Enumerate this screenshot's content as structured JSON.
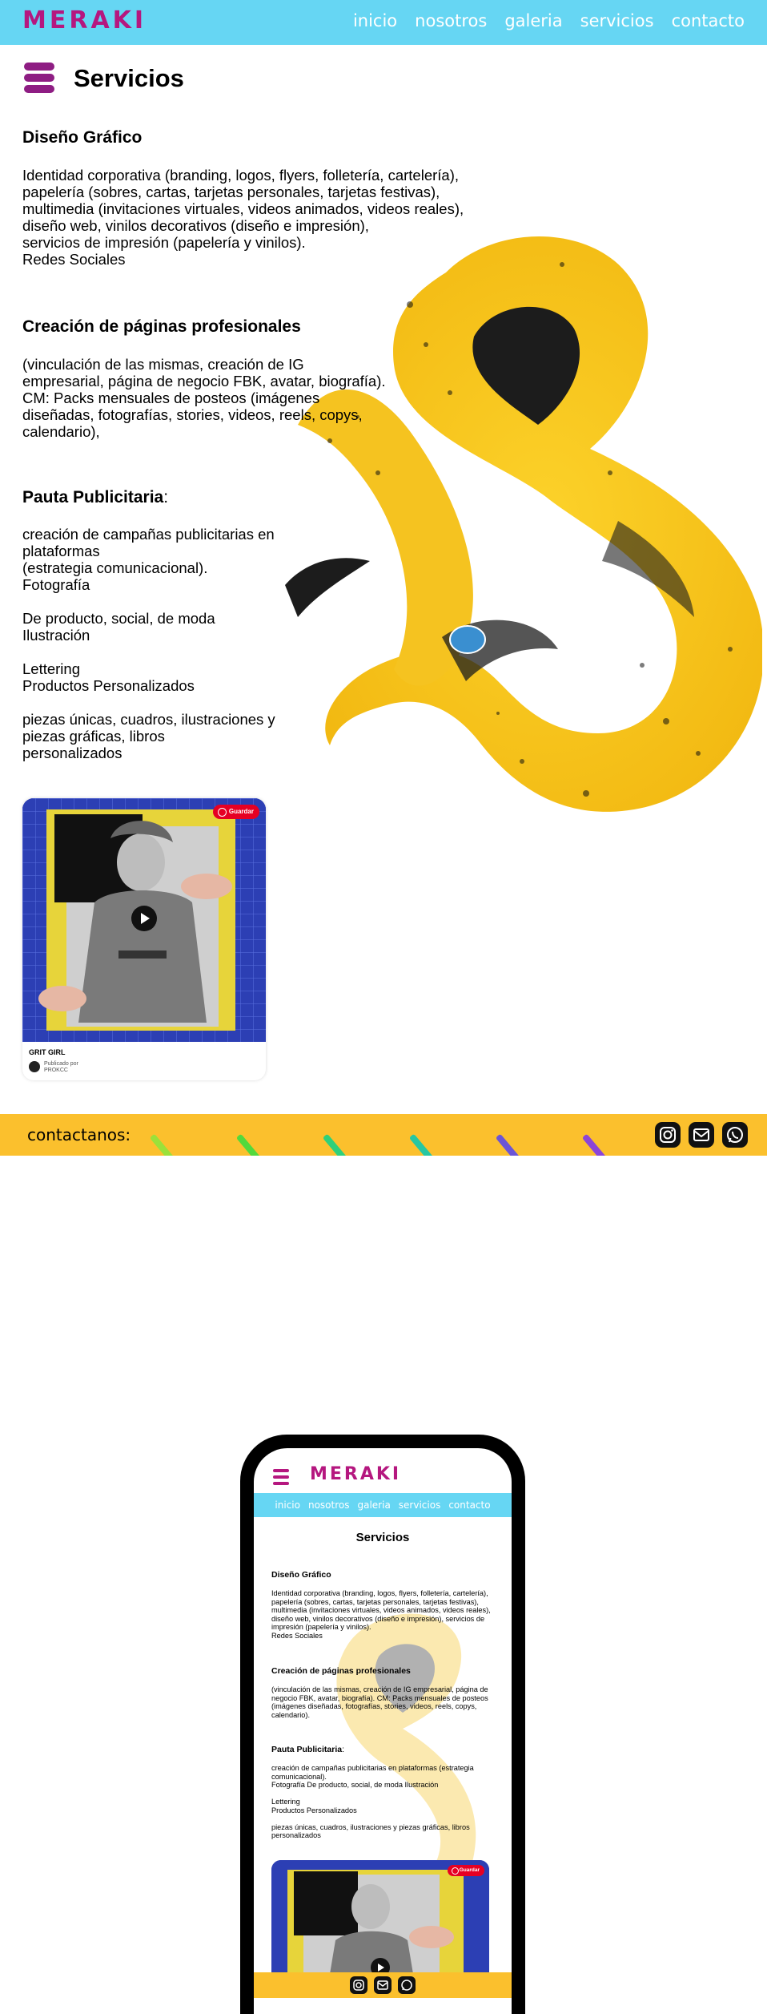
{
  "brand": {
    "logo": "MERAKI",
    "accent": "#b5177f",
    "nav_bg": "#66d6f3",
    "footer_bg": "#fbc02d"
  },
  "nav": {
    "links": [
      "inicio",
      "nosotros",
      "galeria",
      "servicios",
      "contacto"
    ]
  },
  "page": {
    "title": "Servicios"
  },
  "services": [
    {
      "title": "Diseño Gráfico",
      "body": "Identidad corporativa (branding, logos, flyers, folletería, cartelería),\npapelería (sobres, cartas, tarjetas personales, tarjetas festivas),\nmultimedia (invitaciones virtuales, videos animados, videos reales),\ndiseño web, vinilos decorativos (diseño e impresión),\nservicios de impresión (papelería y vinilos).\nRedes Sociales"
    },
    {
      "title": "Creación de páginas profesionales",
      "body": "(vinculación de las mismas, creación de IG\nempresarial, página de negocio FBK, avatar, biografía).\nCM: Packs mensuales de posteos (imágenes\ndiseñadas, fotografías, stories, videos, reels, copys,\ncalendario),"
    },
    {
      "title": "Pauta Publicitaria",
      "title_suffix": ":",
      "body": "creación de campañas publicitarias en\nplataformas\n(estrategia comunicacional).\nFotografía\n\nDe producto, social, de moda\nIlustración\n\nLettering\nProductos Personalizados\n\npiezas únicas, cuadros, ilustraciones y\npiezas gráficas, libros\npersonalizados"
    }
  ],
  "video_card": {
    "save_label": "Guardar",
    "title": "GRIT GIRL",
    "published_label": "Publicado por",
    "publisher": "PROKCC"
  },
  "footer": {
    "label": "contactanos:",
    "stripe_colors": [
      "#9be13a",
      "#52d93c",
      "#2fd07a",
      "#27c7a2",
      "#6b55d6",
      "#8c45d8"
    ],
    "social_icons": [
      "instagram-icon",
      "mail-icon",
      "whatsapp-icon"
    ]
  },
  "mobile": {
    "services": [
      {
        "title": "Diseño Gráfico",
        "body": "Identidad corporativa (branding, logos, flyers, folletería, cartelería),\npapelería (sobres, cartas, tarjetas personales, tarjetas festivas),\nmultimedia (invitaciones virtuales, videos animados, videos reales),\ndiseño web, vinilos decorativos (diseño e impresión), servicios de\nimpresión (papelería y vinilos).\nRedes Sociales"
      },
      {
        "title": "Creación de páginas profesionales",
        "body": "(vinculación de las mismas, creación de IG empresarial, página de\nnegocio FBK, avatar, biografía). CM: Packs mensuales de posteos\n(imágenes diseñadas, fotografías, stories, videos, reels, copys,\ncalendario)."
      },
      {
        "title": "Pauta Publicitaria",
        "title_suffix": ":",
        "body": "creación de campañas publicitarias en plataformas (estrategia\ncomunicacional).\nFotografía De producto, social, de moda Ilustración\n\nLettering\nProductos Personalizados\n\npiezas únicas, cuadros, ilustraciones y piezas gráficas, libros\npersonalizados"
      }
    ]
  }
}
